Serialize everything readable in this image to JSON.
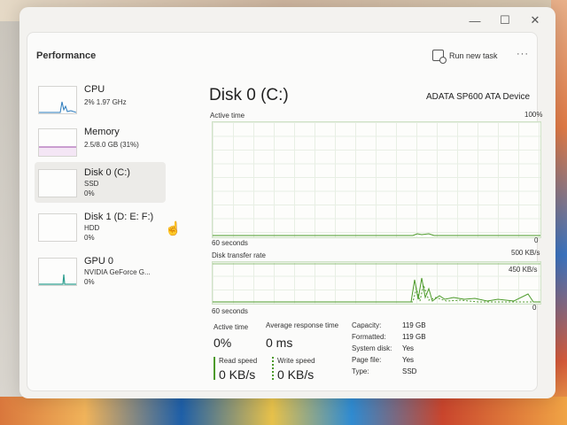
{
  "header": {
    "title": "Performance",
    "run_new_task": "Run new task",
    "more": "···"
  },
  "window_buttons": {
    "minimize": "—",
    "maximize": "☐",
    "close": "✕"
  },
  "sidebar": {
    "items": [
      {
        "name": "CPU",
        "line1": "2% 1.97 GHz",
        "line2": ""
      },
      {
        "name": "Memory",
        "line1": "2.5/8.0 GB (31%)",
        "line2": ""
      },
      {
        "name": "Disk 0 (C:)",
        "line1": "SSD",
        "line2": "0%"
      },
      {
        "name": "Disk 1 (D: E: F:)",
        "line1": "HDD",
        "line2": "0%"
      },
      {
        "name": "GPU 0",
        "line1": "NVIDIA GeForce G...",
        "line2": "0%"
      }
    ]
  },
  "main": {
    "title": "Disk 0 (C:)",
    "device": "ADATA SP600 ATA Device",
    "active_time_graph": {
      "label": "Active time",
      "max": "100%",
      "duration": "60 seconds",
      "min": "0"
    },
    "transfer_graph": {
      "label": "Disk transfer rate",
      "max": "500 KB/s",
      "mid": "450 KB/s",
      "duration": "60 seconds",
      "min": "0"
    },
    "stats": {
      "active_time_label": "Active time",
      "active_time_value": "0%",
      "avg_response_label": "Average response time",
      "avg_response_value": "0 ms",
      "read_speed_label": "Read speed",
      "read_speed_value": "0 KB/s",
      "write_speed_label": "Write speed",
      "write_speed_value": "0 KB/s"
    },
    "info": [
      {
        "label": "Capacity:",
        "value": "119 GB"
      },
      {
        "label": "Formatted:",
        "value": "119 GB"
      },
      {
        "label": "System disk:",
        "value": "Yes"
      },
      {
        "label": "Page file:",
        "value": "Yes"
      },
      {
        "label": "Type:",
        "value": "SSD"
      }
    ]
  },
  "colors": {
    "disk_accent": "#4c9a2a",
    "cpu_accent": "#2b7bbd",
    "memory_accent": "#9b4aa8",
    "gpu_accent": "#2e9e8f"
  }
}
